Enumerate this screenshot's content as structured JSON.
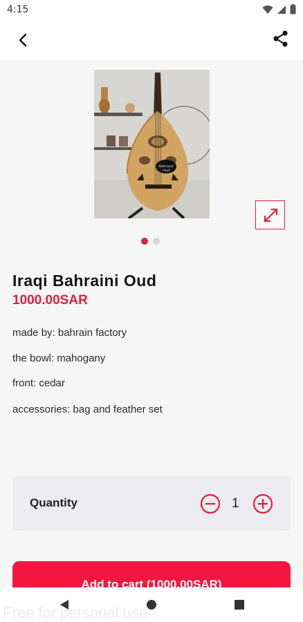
{
  "status_bar": {
    "time": "4:15"
  },
  "product": {
    "title": "Iraqi Bahraini Oud",
    "price": "1000.00SAR",
    "image_label": "Bahraini Oud"
  },
  "specs": [
    "made by: bahrain factory",
    "the bowl: mahogany",
    "front: cedar",
    "accessories: bag and feather set"
  ],
  "quantity": {
    "label": "Quantity",
    "value": "1"
  },
  "add_to_cart": {
    "label": "Add to cart (1000.00SAR)"
  },
  "carousel": {
    "current": 1,
    "total": 2
  },
  "watermark": "Free for personal use",
  "colors": {
    "accent": "#e31d3c",
    "button": "#f5163f"
  }
}
